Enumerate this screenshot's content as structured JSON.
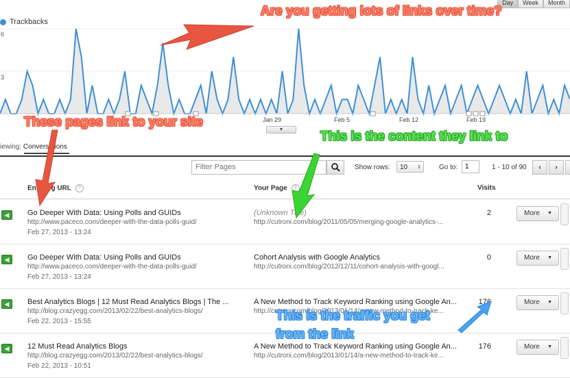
{
  "chart": {
    "legend": "Trackbacks",
    "legend_color": "#3d8fd6",
    "y_ticks": [
      "6",
      "3"
    ],
    "x_ticks": [
      "Jan 29",
      "Feb 5",
      "Feb 12",
      "Feb 19"
    ],
    "top_buttons": [
      "Day",
      "Week",
      "Month"
    ]
  },
  "chart_data": {
    "type": "area",
    "series": [
      {
        "name": "Trackbacks",
        "values": [
          0,
          1,
          0,
          0,
          1,
          3,
          2,
          0,
          1,
          0,
          0,
          1,
          0,
          1,
          6,
          4,
          0,
          2,
          0,
          0,
          1,
          0,
          1,
          3,
          0,
          0,
          2,
          1,
          0,
          2,
          5,
          2,
          0,
          1,
          0,
          0,
          1,
          2,
          0,
          3,
          1,
          0,
          1,
          4,
          1,
          0,
          1,
          0,
          1,
          0,
          1,
          0,
          3,
          0,
          1,
          6,
          2,
          0,
          1,
          0,
          1,
          2,
          0,
          1,
          1,
          0,
          2,
          1,
          0,
          2,
          4,
          0,
          1,
          0,
          1,
          0,
          4,
          1,
          0,
          2,
          0,
          1,
          2,
          0,
          1,
          2,
          0,
          1,
          2,
          1,
          0,
          1,
          2,
          1,
          0,
          1,
          0,
          3,
          0,
          1,
          2,
          0,
          1,
          0,
          2,
          1
        ],
        "color": "#3d8fd6"
      }
    ],
    "ylim": [
      0,
      6
    ]
  },
  "viewing": {
    "prefix": "iewing:",
    "value": "Conversations"
  },
  "toolbar": {
    "filter_placeholder": "Filter Pages",
    "show_rows_label": "Show rows:",
    "rows_value": "10",
    "goto_label": "Go to:",
    "goto_value": "1",
    "range": "1 - 10 of 90"
  },
  "table": {
    "headers": {
      "col1": "Entering URL",
      "col2": "Your Page",
      "col3": "Visits"
    },
    "more_label": "More",
    "rows": [
      {
        "title": "Go Deeper With Data: Using Polls and GUIDs",
        "url": "http://www.paceco.com/deeper-with-the-data-polls-guid/",
        "date": "Feb 27, 2013 - 13:24",
        "page_title": "(Unknown Title)",
        "page_url": "http://cutroni.com/blog/2011/05/05/merging-google-analytics-...",
        "visits": "2",
        "unknown": true
      },
      {
        "title": "Go Deeper With Data: Using Polls and GUIDs",
        "url": "http://www.paceco.com/deeper-with-the-data-polls-guid/",
        "date": "Feb 27, 2013 - 13:24",
        "page_title": "Cohort Analysis with Google Analytics",
        "page_url": "http://cutroni.com/blog/2012/12/11/cohort-analysis-with-googl...",
        "visits": "0",
        "unknown": false
      },
      {
        "title": "Best Analytics Blogs | 12 Must Read Analytics Blogs | The ...",
        "url": "http://blog.crazyegg.com/2013/02/22/best-analytics-blogs/",
        "date": "Feb 22, 2013 - 15:55",
        "page_title": "A New Method to Track Keyword Ranking using Google An...",
        "page_url": "http://cutroni.com/blog/2013/01/14/a-new-method-to-track-ke...",
        "visits": "176",
        "unknown": false
      },
      {
        "title": "12 Must Read Analytics Blogs",
        "url": "http://blog.crazyegg.com/2013/02/22/best-analytics-blogs/",
        "date": "Feb 22, 2013 - 10:51",
        "page_title": "A New Method to Track Keyword Ranking using Google An...",
        "page_url": "http://cutroni.com/blog/2013/01/14/a-new-method-to-track-ke...",
        "visits": "176",
        "unknown": false
      }
    ]
  },
  "annotations": {
    "links_over_time": "Are you getting lots of links over time?",
    "pages_link": "These pages link to your site",
    "content_link": "This is the content they link to",
    "traffic_line1": "This is the traffic you get",
    "traffic_line2": "from the link"
  }
}
